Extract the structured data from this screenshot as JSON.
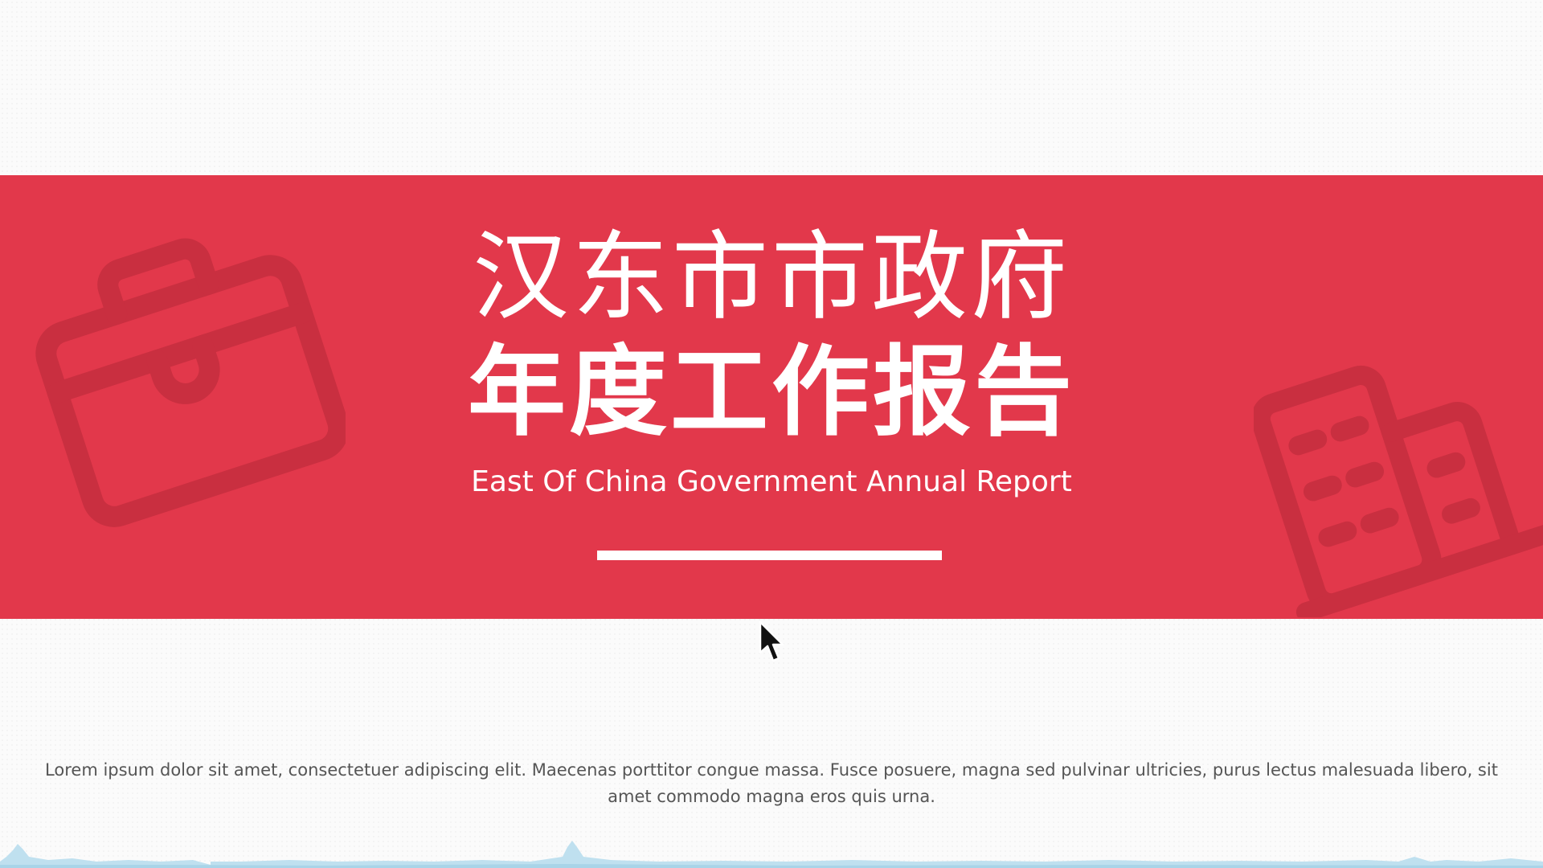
{
  "slide": {
    "title_line1": "汉东市市政府",
    "title_line2": "年度工作报告",
    "subtitle": "East Of China Government Annual Report",
    "body_text": "Lorem ipsum dolor sit amet, consectetuer adipiscing elit. Maecenas porttitor congue massa. Fusce posuere, magna sed pulvinar ultricies, purus lectus malesuada libero, sit amet commodo magna eros quis urna."
  },
  "icons": {
    "background_left": "briefcase-icon",
    "background_right": "building-icon",
    "pointer": "cursor-icon"
  },
  "colors": {
    "banner": "#e2384b",
    "banner_icon": "#c92f40",
    "text_on_banner": "#ffffff",
    "body_text": "#555555",
    "waveform": "#bfe0ef"
  }
}
